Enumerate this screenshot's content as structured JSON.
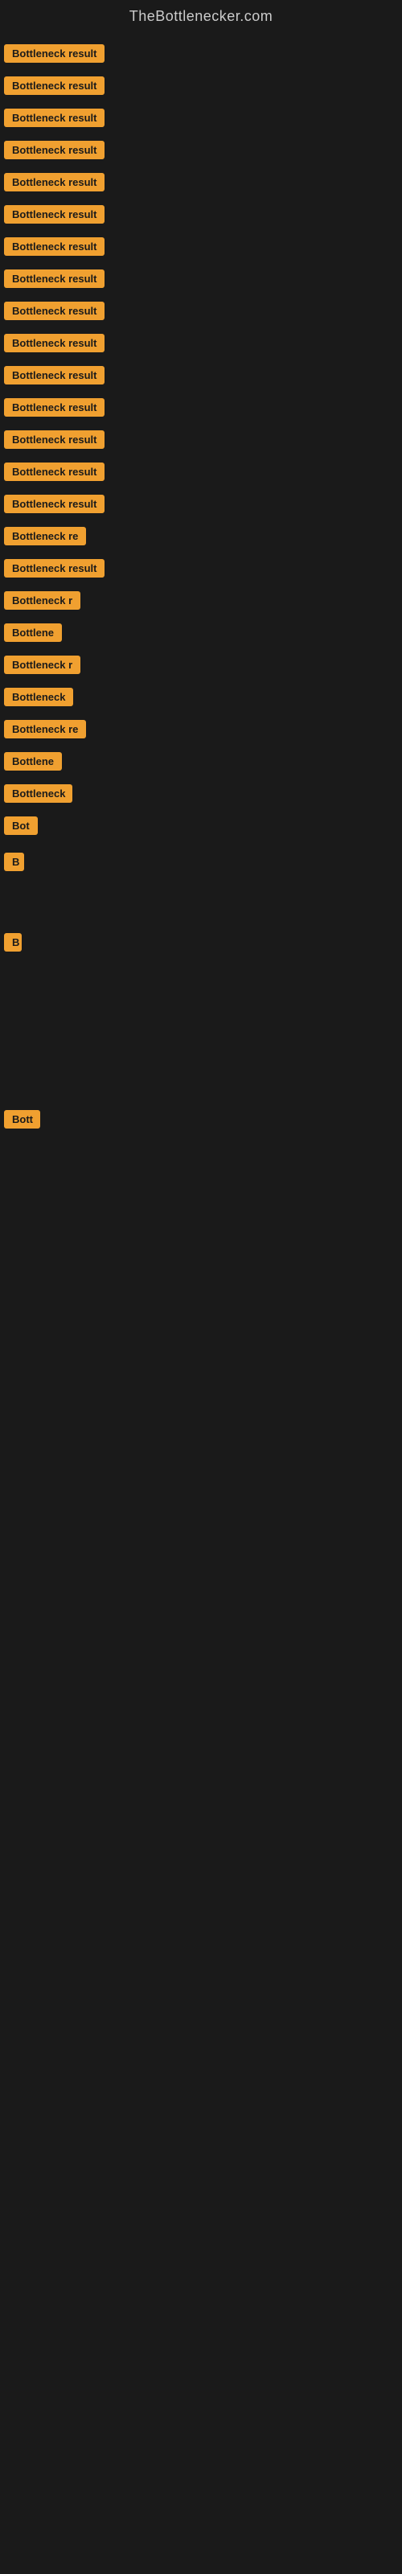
{
  "site": {
    "title": "TheBottlenecker.com"
  },
  "rows": [
    {
      "id": 1,
      "label": "Bottleneck result"
    },
    {
      "id": 2,
      "label": "Bottleneck result"
    },
    {
      "id": 3,
      "label": "Bottleneck result"
    },
    {
      "id": 4,
      "label": "Bottleneck result"
    },
    {
      "id": 5,
      "label": "Bottleneck result"
    },
    {
      "id": 6,
      "label": "Bottleneck result"
    },
    {
      "id": 7,
      "label": "Bottleneck result"
    },
    {
      "id": 8,
      "label": "Bottleneck result"
    },
    {
      "id": 9,
      "label": "Bottleneck result"
    },
    {
      "id": 10,
      "label": "Bottleneck result"
    },
    {
      "id": 11,
      "label": "Bottleneck result"
    },
    {
      "id": 12,
      "label": "Bottleneck result"
    },
    {
      "id": 13,
      "label": "Bottleneck result"
    },
    {
      "id": 14,
      "label": "Bottleneck result"
    },
    {
      "id": 15,
      "label": "Bottleneck result"
    },
    {
      "id": 16,
      "label": "Bottleneck re"
    },
    {
      "id": 17,
      "label": "Bottleneck result"
    },
    {
      "id": 18,
      "label": "Bottleneck r"
    },
    {
      "id": 19,
      "label": "Bottlene"
    },
    {
      "id": 20,
      "label": "Bottleneck r"
    },
    {
      "id": 21,
      "label": "Bottleneck"
    },
    {
      "id": 22,
      "label": "Bottleneck re"
    },
    {
      "id": 23,
      "label": "Bottlene"
    },
    {
      "id": 24,
      "label": "Bottleneck"
    },
    {
      "id": 25,
      "label": "Bot"
    },
    {
      "id": 26,
      "label": "B"
    },
    {
      "id": 27,
      "label": ""
    },
    {
      "id": 28,
      "label": "B"
    },
    {
      "id": 29,
      "label": ""
    },
    {
      "id": 30,
      "label": ""
    },
    {
      "id": 31,
      "label": ""
    },
    {
      "id": 32,
      "label": "Bott"
    },
    {
      "id": 33,
      "label": ""
    },
    {
      "id": 34,
      "label": ""
    },
    {
      "id": 35,
      "label": ""
    }
  ]
}
